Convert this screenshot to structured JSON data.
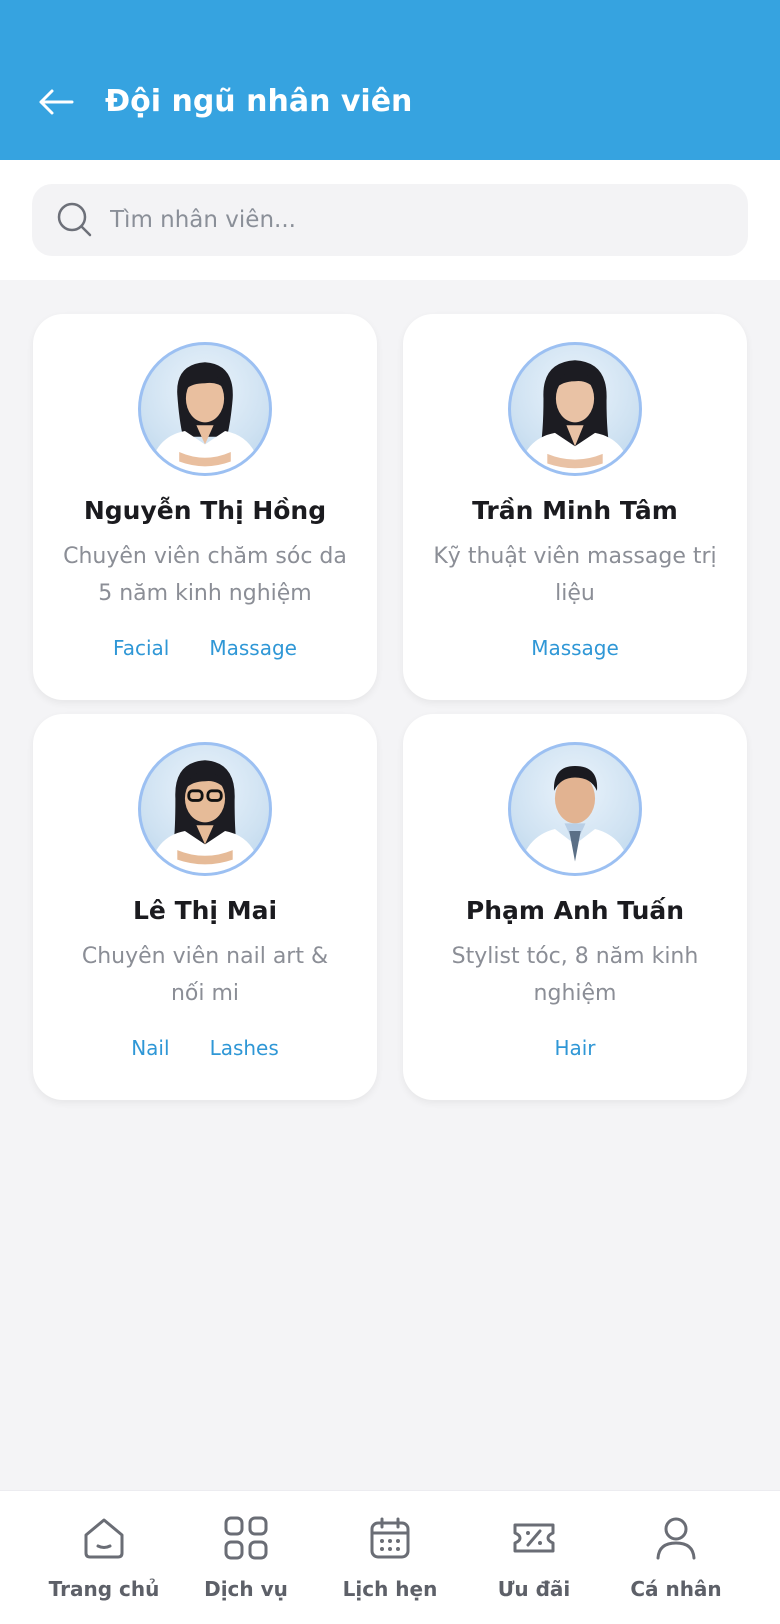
{
  "header": {
    "title": "Đội ngũ nhân viên",
    "back_icon": "arrow-left-icon"
  },
  "search": {
    "placeholder": "Tìm nhân viên...",
    "value": ""
  },
  "staff": [
    {
      "name": "Nguyễn Thị Hồng",
      "role": "Chuyên viên chăm sóc da 5 năm kinh nghiệm",
      "tags": [
        "Facial",
        "Massage"
      ]
    },
    {
      "name": "Trần Minh Tâm",
      "role": "Kỹ thuật viên massage trị liệu",
      "tags": [
        "Massage"
      ]
    },
    {
      "name": "Lê Thị Mai",
      "role": "Chuyên viên nail art & nối mi",
      "tags": [
        "Nail",
        "Lashes"
      ]
    },
    {
      "name": "Phạm Anh Tuấn",
      "role": "Stylist tóc, 8 năm kinh nghiệm",
      "tags": [
        "Hair"
      ]
    }
  ],
  "bottom_nav": [
    {
      "label": "Trang chủ",
      "icon": "home-icon"
    },
    {
      "label": "Dịch vụ",
      "icon": "grid-icon"
    },
    {
      "label": "Lịch hẹn",
      "icon": "calendar-icon"
    },
    {
      "label": "Ưu đãi",
      "icon": "ticket-icon"
    },
    {
      "label": "Cá nhân",
      "icon": "user-icon"
    }
  ],
  "colors": {
    "primary": "#36a3e0",
    "tag": "#2f97d6",
    "avatar_border": "#9cc0f2"
  }
}
